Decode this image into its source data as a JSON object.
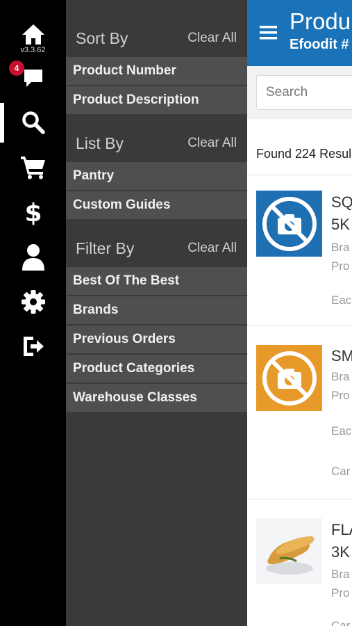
{
  "rail": {
    "version": "v3.3.62",
    "messages_badge": "4",
    "icons": [
      "home-icon",
      "chat-icon",
      "search-icon",
      "cart-icon",
      "dollar-icon",
      "user-icon",
      "gear-icon",
      "logout-icon"
    ]
  },
  "drawer": {
    "sort": {
      "title": "Sort By",
      "clear": "Clear All",
      "options": [
        "Product Number",
        "Product Description"
      ]
    },
    "list": {
      "title": "List By",
      "clear": "Clear All",
      "options": [
        "Pantry",
        "Custom Guides"
      ]
    },
    "filter": {
      "title": "Filter By",
      "clear": "Clear All",
      "options": [
        "Best Of The Best",
        "Brands",
        "Previous Orders",
        "Product Categories",
        "Warehouse Classes"
      ]
    }
  },
  "main": {
    "title": "Produ",
    "subtitle": "Efoodit #",
    "search_placeholder": "Search",
    "found_text": "Found 224 Resul",
    "products": [
      {
        "line1": "SQ",
        "line2": "5K",
        "brand": "Bra",
        "prod": "Pro",
        "unit": "Eac",
        "extra": "",
        "thumb_color": "#1f6fb3",
        "thumb": "no-photo-icon"
      },
      {
        "line1": "SM",
        "line2": "",
        "brand": "Bra",
        "prod": "Pro",
        "unit": "Eac",
        "extra": "Car",
        "thumb_color": "#e79a2a",
        "thumb": "no-photo-icon"
      },
      {
        "line1": "FLA",
        "line2": "3K",
        "brand": "Bra",
        "prod": "Pro",
        "unit": "",
        "extra": "Car",
        "thumb_color": "#ffffff",
        "thumb": "food-photo"
      }
    ]
  }
}
